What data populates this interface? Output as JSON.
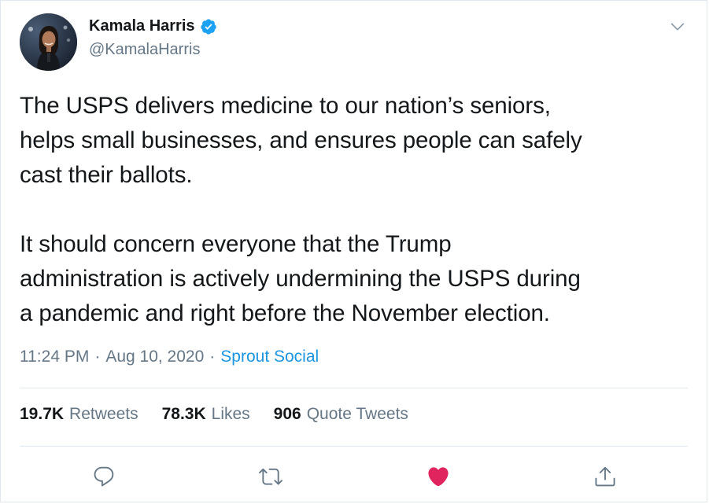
{
  "author": {
    "display_name": "Kamala Harris",
    "handle": "@KamalaHarris",
    "verified": true
  },
  "tweet": {
    "text": "The USPS delivers medicine to our nation’s seniors,\nhelps small businesses, and ensures people can safely\ncast their ballots.\n\nIt should concern everyone that the Trump\nadministration is actively undermining the USPS during\na pandemic and right before the November election.",
    "time": "11:24 PM",
    "separator": "·",
    "date": "Aug 10, 2020",
    "source": "Sprout Social"
  },
  "stats": {
    "retweets_count": "19.7K",
    "retweets_label": "Retweets",
    "likes_count": "78.3K",
    "likes_label": "Likes",
    "quotes_count": "906",
    "quotes_label": "Quote Tweets"
  },
  "actions": {
    "reply_icon": "reply-icon",
    "retweet_icon": "retweet-icon",
    "like_icon": "heart-icon",
    "share_icon": "share-icon"
  },
  "colors": {
    "link": "#1b95e0",
    "secondary_text": "#657786",
    "like": "#e0245e",
    "verified": "#1da1f2"
  }
}
